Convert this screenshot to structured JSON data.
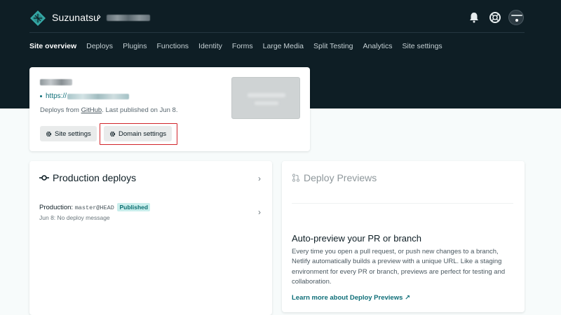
{
  "header": {
    "team_name": "Suzunatsu",
    "separator": "›"
  },
  "nav": {
    "items": [
      {
        "label": "Site overview",
        "active": true
      },
      {
        "label": "Deploys"
      },
      {
        "label": "Plugins"
      },
      {
        "label": "Functions"
      },
      {
        "label": "Identity"
      },
      {
        "label": "Forms"
      },
      {
        "label": "Large Media"
      },
      {
        "label": "Split Testing"
      },
      {
        "label": "Analytics"
      },
      {
        "label": "Site settings"
      }
    ]
  },
  "site_card": {
    "url_prefix": "https://",
    "deploys_from_prefix": "Deploys from ",
    "deploys_from_link": "GitHub",
    "deploys_from_suffix": ". Last published on Jun 8.",
    "site_settings_label": "Site settings",
    "domain_settings_label": "Domain settings"
  },
  "production": {
    "title": "Production deploys",
    "row_label": "Production",
    "row_colon": ":",
    "row_branch": "master@HEAD",
    "row_badge": "Published",
    "row_sub": "Jun 8: No deploy message"
  },
  "previews": {
    "title": "Deploy Previews",
    "heading": "Auto-preview your PR or branch",
    "description": "Every time you open a pull request, or push new changes to a branch, Netlify automatically builds a preview with a unique URL. Like a staging environment for every PR or branch, previews are perfect for testing and collaboration.",
    "link": "Learn more about Deploy Previews ↗"
  },
  "colors": {
    "header_bg": "#0e1e25",
    "accent_teal": "#0e6e78",
    "highlight_red": "#d1232a",
    "badge_bg": "#c9eeec"
  },
  "icons": [
    "netlify-logo-icon",
    "bell-icon",
    "help-lifebuoy-icon",
    "gear-icon",
    "deploy-commit-icon",
    "pull-request-icon",
    "chevron-right-icon"
  ]
}
